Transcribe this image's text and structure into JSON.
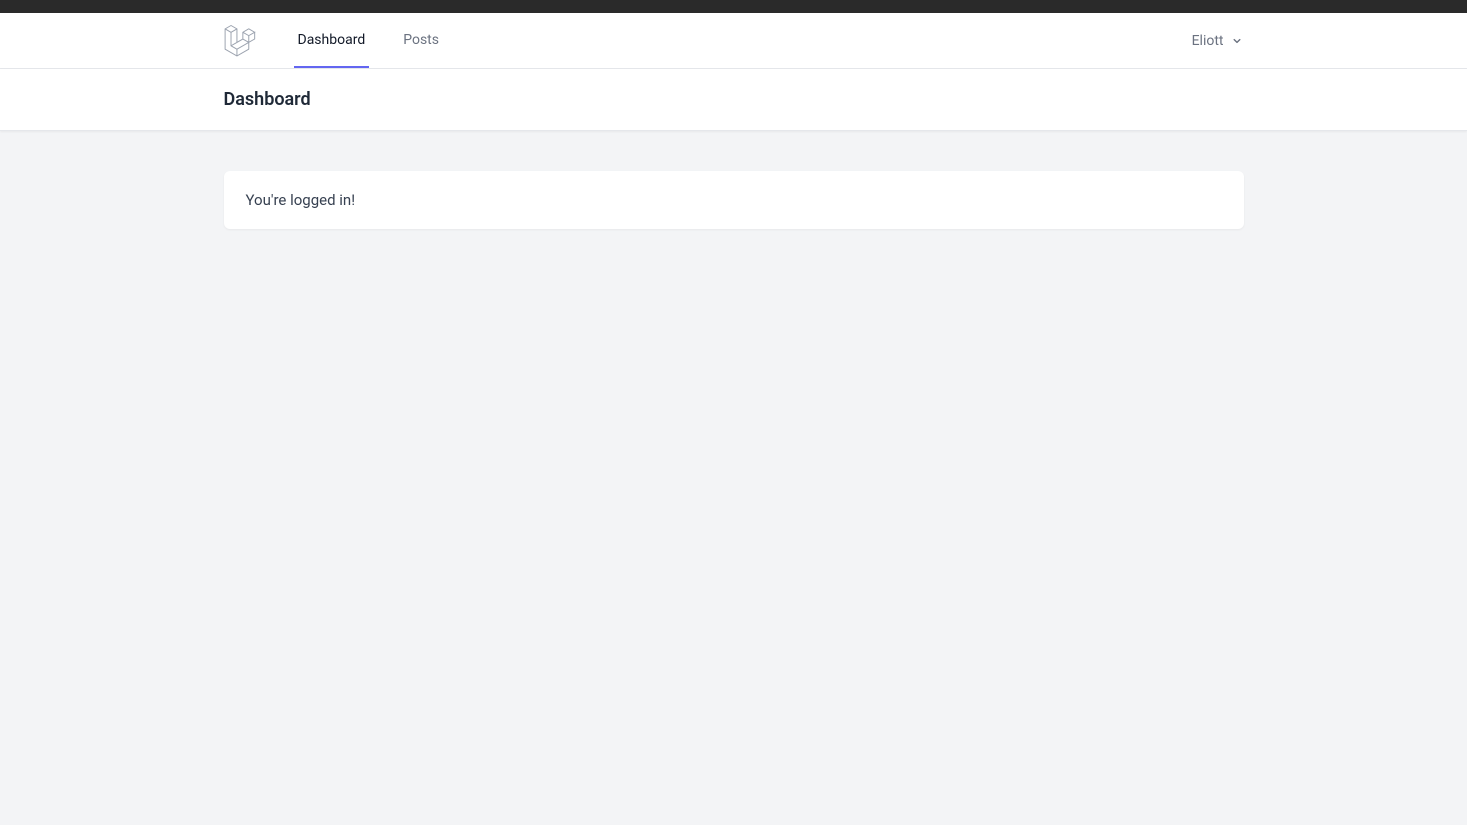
{
  "nav": {
    "links": [
      {
        "label": "Dashboard",
        "active": true
      },
      {
        "label": "Posts",
        "active": false
      }
    ],
    "user_name": "Eliott"
  },
  "page": {
    "title": "Dashboard"
  },
  "content": {
    "message": "You're logged in!"
  }
}
